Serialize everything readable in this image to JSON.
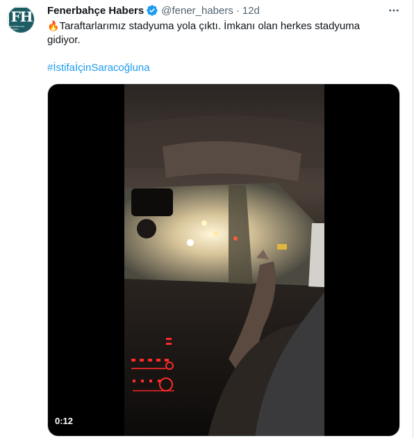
{
  "tweet": {
    "author_name": "Fenerbahçe Habers",
    "author_handle": "@fener_habers",
    "separator": "·",
    "time_ago": "12d",
    "text": "Taraftarlarımız stadyuma yola çıktı. İmkanı olan herkes stadyuma gidiyor.",
    "leading_emoji": "🔥",
    "hashtag": "#İstifaİçinSaracoğluna",
    "avatar_text": "FH",
    "avatar_subtext": "FENERBAHÇE HABERS"
  },
  "media": {
    "duration": "0:12"
  },
  "icons": {
    "verified": "verified-badge-icon",
    "more": "more-dots-icon",
    "fire": "fire-emoji-icon"
  },
  "colors": {
    "accent": "#1d9bf0",
    "text_primary": "#0f1419",
    "text_secondary": "#536471",
    "avatar_bg": "#1d5c63"
  }
}
